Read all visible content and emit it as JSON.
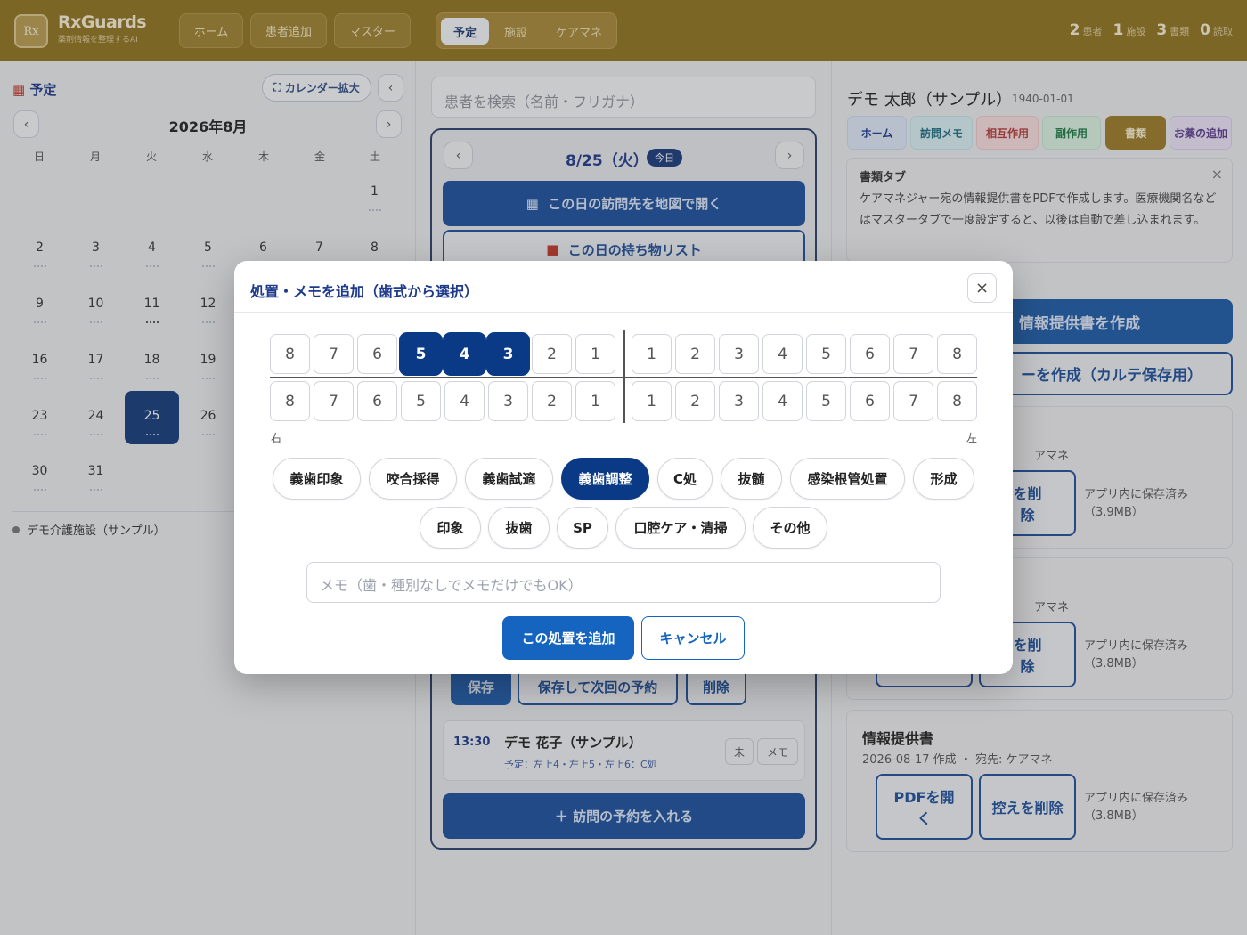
{
  "header": {
    "brand": "RxGuards",
    "brand_sub": "薬剤情報を整理するAI",
    "logo_text": "Rx",
    "nav": [
      "ホーム",
      "患者追加",
      "マスター"
    ],
    "segments": [
      "予定",
      "施設",
      "ケアマネ"
    ],
    "active_segment": "予定",
    "stats": [
      {
        "num": "2",
        "label": "患者"
      },
      {
        "num": "1",
        "label": "施設"
      },
      {
        "num": "3",
        "label": "書類"
      },
      {
        "num": "0",
        "label": "読取"
      }
    ]
  },
  "calendar": {
    "title": "予定",
    "expand": "カレンダー拡大",
    "collapse": "‹",
    "month": "2026年8月",
    "prev": "‹",
    "next": "›",
    "weekdays": [
      "日",
      "月",
      "火",
      "水",
      "木",
      "金",
      "土"
    ],
    "days": [
      "1",
      "2",
      "3",
      "4",
      "5",
      "6",
      "7",
      "8",
      "9",
      "10",
      "11",
      "12",
      "16",
      "17",
      "18",
      "19",
      "23",
      "24",
      "25",
      "26",
      "30",
      "31"
    ],
    "selected": "25",
    "legend": "デモ介護施設（サンプル）"
  },
  "middle": {
    "search_placeholder": "患者を検索（名前・フリガナ）",
    "date": "8/25（火）",
    "today": "今日",
    "prev": "‹",
    "next": "›",
    "map_btn": "この日の訪問先を地図で開く",
    "items_btn": "この日の持ち物リスト",
    "save": "保存",
    "save_next": "保存して次回の予約",
    "delete": "削除",
    "appt": {
      "time": "13:30",
      "name": "デモ 花子（サンプル）",
      "detail": "予定：左上4・左上5・左上6：C処",
      "tag1": "未",
      "tag2": "メモ"
    },
    "add_appt": "＋ 訪問の予約を入れる"
  },
  "right": {
    "patient": "デモ 太郎（サンプル）",
    "dob": "1940-01-01",
    "tabs": [
      "ホーム",
      "訪問メモ",
      "相互作用",
      "副作用",
      "書類",
      "お薬の追加"
    ],
    "active_tab": "書類",
    "note_title": "書類タブ",
    "note_body": "ケアマネジャー宛の情報提供書をPDFで作成します。医療機関名などはマスタータブで一度設定すると、以後は自動で差し込まれます。",
    "create_btn": "情報提供書を作成",
    "create_btn2": "ーを作成（カルテ保存用）",
    "card_frag1": "アマネ",
    "card_frag2": "アマネ",
    "copy_del_frag": "を削\n除",
    "saved1": "アプリ内に保存済み",
    "size1": "（3.9MB）",
    "saved2": "アプリ内に保存済み",
    "size2": "（3.8MB）",
    "card3_title": "情報提供書",
    "card3_sub": "2026-08-17 作成 ・ 宛先: ケアマネ",
    "open_pdf": "PDFを開く",
    "copy_del": "控えを削除",
    "saved3": "アプリ内に保存済み",
    "size3": "（3.8MB）"
  },
  "modal": {
    "title": "処置・メモを追加（歯式から選択）",
    "close": "×",
    "upper_right": [
      "8",
      "7",
      "6",
      "5",
      "4",
      "3",
      "2",
      "1"
    ],
    "upper_left": [
      "1",
      "2",
      "3",
      "4",
      "5",
      "6",
      "7",
      "8"
    ],
    "lower_right": [
      "8",
      "7",
      "6",
      "5",
      "4",
      "3",
      "2",
      "1"
    ],
    "lower_left": [
      "1",
      "2",
      "3",
      "4",
      "5",
      "6",
      "7",
      "8"
    ],
    "selected_upper_right": [
      "5",
      "4",
      "3"
    ],
    "side_right": "右",
    "side_left": "左",
    "treatments_row1": [
      "義歯印象",
      "咬合採得",
      "義歯試適",
      "義歯調整",
      "C処",
      "抜髄",
      "感染根管処置",
      "形成"
    ],
    "treatments_row2": [
      "印象",
      "抜歯",
      "SP",
      "口腔ケア・清掃",
      "その他"
    ],
    "selected_treatment": "義歯調整",
    "memo_placeholder": "メモ（歯・種別なしでメモだけでもOK）",
    "add": "この処置を追加",
    "cancel": "キャンセル"
  }
}
